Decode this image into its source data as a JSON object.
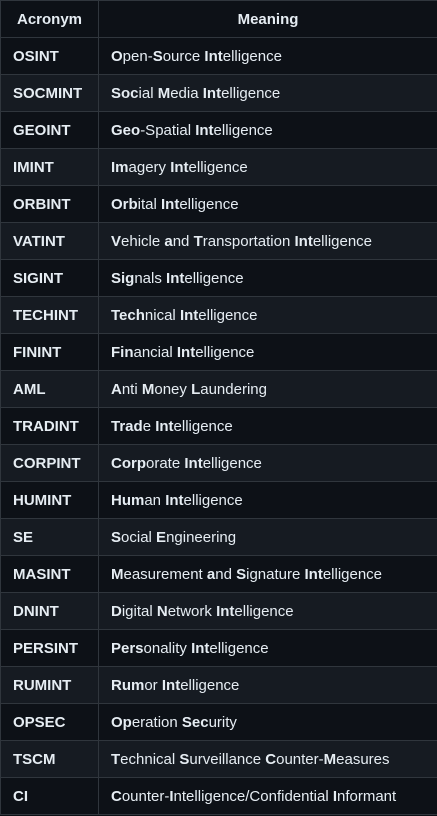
{
  "table": {
    "headers": [
      "Acronym",
      "Meaning"
    ],
    "rows": [
      {
        "acronym": "OSINT",
        "meaning": [
          [
            "b",
            "O"
          ],
          [
            "n",
            "pen-"
          ],
          [
            "b",
            "S"
          ],
          [
            "n",
            "ource "
          ],
          [
            "b",
            "Int"
          ],
          [
            "n",
            "elligence"
          ]
        ]
      },
      {
        "acronym": "SOCMINT",
        "meaning": [
          [
            "b",
            "Soc"
          ],
          [
            "n",
            "ial "
          ],
          [
            "b",
            "M"
          ],
          [
            "n",
            "edia "
          ],
          [
            "b",
            "Int"
          ],
          [
            "n",
            "elligence"
          ]
        ]
      },
      {
        "acronym": "GEOINT",
        "meaning": [
          [
            "b",
            "Geo"
          ],
          [
            "n",
            "-Spatial "
          ],
          [
            "b",
            "Int"
          ],
          [
            "n",
            "elligence"
          ]
        ]
      },
      {
        "acronym": "IMINT",
        "meaning": [
          [
            "b",
            "Im"
          ],
          [
            "n",
            "agery "
          ],
          [
            "b",
            "Int"
          ],
          [
            "n",
            "elligence"
          ]
        ]
      },
      {
        "acronym": "ORBINT",
        "meaning": [
          [
            "b",
            "Orb"
          ],
          [
            "n",
            "ital "
          ],
          [
            "b",
            "Int"
          ],
          [
            "n",
            "elligence"
          ]
        ]
      },
      {
        "acronym": "VATINT",
        "meaning": [
          [
            "b",
            "V"
          ],
          [
            "n",
            "ehicle "
          ],
          [
            "b",
            "a"
          ],
          [
            "n",
            "nd "
          ],
          [
            "b",
            "T"
          ],
          [
            "n",
            "ransportation "
          ],
          [
            "b",
            "Int"
          ],
          [
            "n",
            "elligence"
          ]
        ]
      },
      {
        "acronym": "SIGINT",
        "meaning": [
          [
            "b",
            "Sig"
          ],
          [
            "n",
            "nals "
          ],
          [
            "b",
            "Int"
          ],
          [
            "n",
            "elligence"
          ]
        ]
      },
      {
        "acronym": "TECHINT",
        "meaning": [
          [
            "b",
            "Tech"
          ],
          [
            "n",
            "nical "
          ],
          [
            "b",
            "Int"
          ],
          [
            "n",
            "elligence"
          ]
        ]
      },
      {
        "acronym": "FININT",
        "meaning": [
          [
            "b",
            "Fin"
          ],
          [
            "n",
            "ancial "
          ],
          [
            "b",
            "Int"
          ],
          [
            "n",
            "elligence"
          ]
        ]
      },
      {
        "acronym": "AML",
        "meaning": [
          [
            "b",
            "A"
          ],
          [
            "n",
            "nti "
          ],
          [
            "b",
            "M"
          ],
          [
            "n",
            "oney "
          ],
          [
            "b",
            "L"
          ],
          [
            "n",
            "aundering"
          ]
        ]
      },
      {
        "acronym": "TRADINT",
        "meaning": [
          [
            "b",
            "Trad"
          ],
          [
            "n",
            "e "
          ],
          [
            "b",
            "Int"
          ],
          [
            "n",
            "elligence"
          ]
        ]
      },
      {
        "acronym": "CORPINT",
        "meaning": [
          [
            "b",
            "Corp"
          ],
          [
            "n",
            "orate "
          ],
          [
            "b",
            "Int"
          ],
          [
            "n",
            "elligence"
          ]
        ]
      },
      {
        "acronym": "HUMINT",
        "meaning": [
          [
            "b",
            "Hum"
          ],
          [
            "n",
            "an "
          ],
          [
            "b",
            "Int"
          ],
          [
            "n",
            "elligence"
          ]
        ]
      },
      {
        "acronym": "SE",
        "meaning": [
          [
            "b",
            "S"
          ],
          [
            "n",
            "ocial "
          ],
          [
            "b",
            "E"
          ],
          [
            "n",
            "ngineering"
          ]
        ]
      },
      {
        "acronym": "MASINT",
        "meaning": [
          [
            "b",
            "M"
          ],
          [
            "n",
            "easurement "
          ],
          [
            "b",
            "a"
          ],
          [
            "n",
            "nd "
          ],
          [
            "b",
            "S"
          ],
          [
            "n",
            "ignature "
          ],
          [
            "b",
            "Int"
          ],
          [
            "n",
            "elligence"
          ]
        ]
      },
      {
        "acronym": "DNINT",
        "meaning": [
          [
            "b",
            "D"
          ],
          [
            "n",
            "igital "
          ],
          [
            "b",
            "N"
          ],
          [
            "n",
            "etwork "
          ],
          [
            "b",
            "Int"
          ],
          [
            "n",
            "elligence"
          ]
        ]
      },
      {
        "acronym": "PERSINT",
        "meaning": [
          [
            "b",
            "Pers"
          ],
          [
            "n",
            "onality "
          ],
          [
            "b",
            "Int"
          ],
          [
            "n",
            "elligence"
          ]
        ]
      },
      {
        "acronym": "RUMINT",
        "meaning": [
          [
            "b",
            "Rum"
          ],
          [
            "n",
            "or "
          ],
          [
            "b",
            "Int"
          ],
          [
            "n",
            "elligence"
          ]
        ]
      },
      {
        "acronym": "OPSEC",
        "meaning": [
          [
            "b",
            "Op"
          ],
          [
            "n",
            "eration "
          ],
          [
            "b",
            "Sec"
          ],
          [
            "n",
            "urity"
          ]
        ]
      },
      {
        "acronym": "TSCM",
        "meaning": [
          [
            "b",
            "T"
          ],
          [
            "n",
            "echnical "
          ],
          [
            "b",
            "S"
          ],
          [
            "n",
            "urveillance "
          ],
          [
            "b",
            "C"
          ],
          [
            "n",
            "ounter-"
          ],
          [
            "b",
            "M"
          ],
          [
            "n",
            "easures"
          ]
        ]
      },
      {
        "acronym": "CI",
        "meaning": [
          [
            "b",
            "C"
          ],
          [
            "n",
            "ounter-"
          ],
          [
            "b",
            "I"
          ],
          [
            "n",
            "ntelligence/Confidential "
          ],
          [
            "b",
            "I"
          ],
          [
            "n",
            "nformant"
          ]
        ]
      }
    ]
  }
}
